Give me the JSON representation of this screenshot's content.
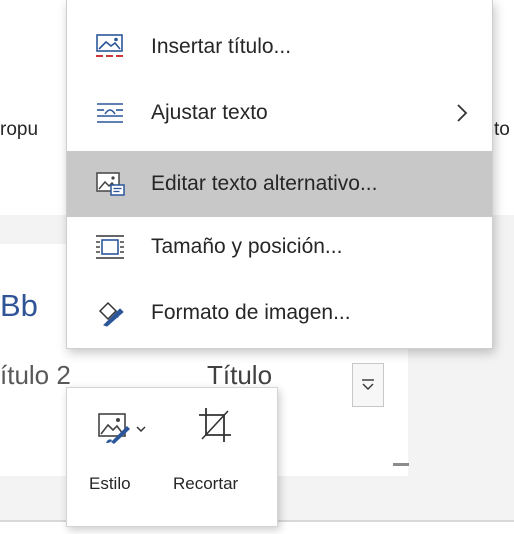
{
  "background": {
    "text_left": "ropu",
    "text_right": "to",
    "style_preview": "Bb",
    "style_heading2": "ítulo 2",
    "style_title": "Título"
  },
  "context_menu": {
    "items": [
      {
        "label": "Insertar título...",
        "icon": "insert-caption-icon",
        "has_submenu": false,
        "highlighted": false
      },
      {
        "label": "Ajustar texto",
        "icon": "wrap-text-icon",
        "has_submenu": true,
        "highlighted": false
      },
      {
        "label": "Editar texto alternativo...",
        "icon": "alt-text-icon",
        "has_submenu": false,
        "highlighted": true
      },
      {
        "label": "Tamaño y posición...",
        "icon": "size-position-icon",
        "has_submenu": false,
        "highlighted": false
      },
      {
        "label": "Formato de imagen...",
        "icon": "format-picture-icon",
        "has_submenu": false,
        "highlighted": false
      }
    ]
  },
  "mini_toolbar": {
    "style_label": "Estilo",
    "style_icon": "picture-style-icon",
    "crop_label": "Recortar",
    "crop_icon": "crop-icon"
  },
  "colors": {
    "highlight": "#c8c8c8",
    "accent_blue": "#2f5597",
    "icon_red": "#d13438"
  }
}
